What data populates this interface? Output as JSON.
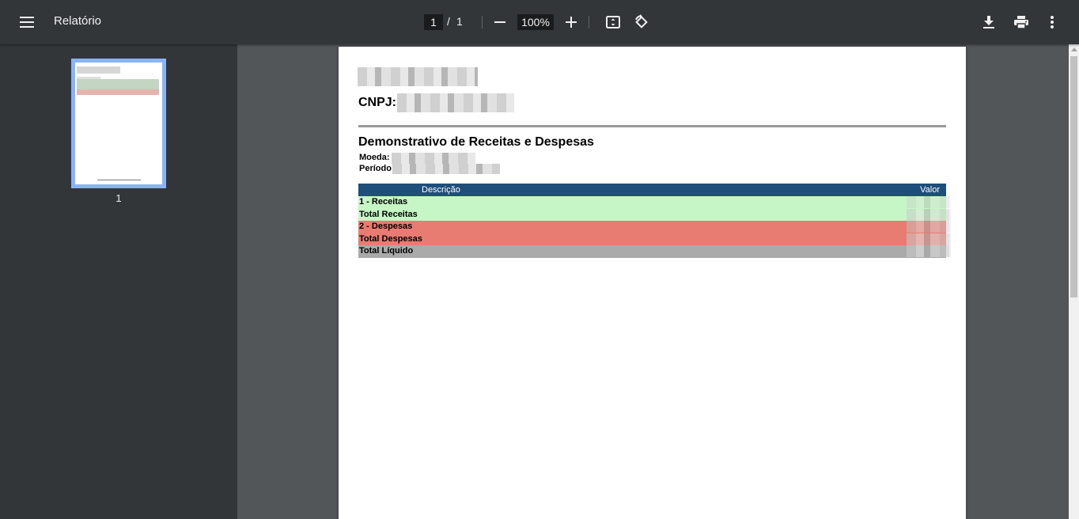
{
  "toolbar": {
    "title": "Relatório",
    "page_current": "1",
    "page_separator": "/",
    "page_total": "1",
    "zoom": "100%",
    "icons": [
      "menu-icon",
      "zoom-out-icon",
      "zoom-in-icon",
      "fit-page-icon",
      "rotate-icon",
      "download-icon",
      "print-icon",
      "more-vert-icon"
    ]
  },
  "sidebar": {
    "thumbnail_label": "1"
  },
  "document": {
    "cnpj_label": "CNPJ:",
    "report_title": "Demonstrativo de Receitas e Despesas",
    "moeda_label": "Moeda:",
    "periodo_label": "Período",
    "table": {
      "headers": [
        "Descrição",
        "Valor"
      ],
      "rows": [
        {
          "label": "1 - Receitas",
          "color": "#c6f5c6"
        },
        {
          "label": "Total Receitas",
          "color": "#c6f5c6"
        },
        {
          "label": "2 - Despesas",
          "color": "#e87c72"
        },
        {
          "label": "Total Despesas",
          "color": "#e87c72"
        },
        {
          "label": "Total Líquido",
          "color": "#aaaaaa"
        }
      ]
    }
  },
  "colors": {
    "toolbar_bg": "#323639",
    "viewer_bg": "#525659",
    "table_header": "#1e4f7b",
    "thumbnail_highlight": "#8ab4f8"
  }
}
